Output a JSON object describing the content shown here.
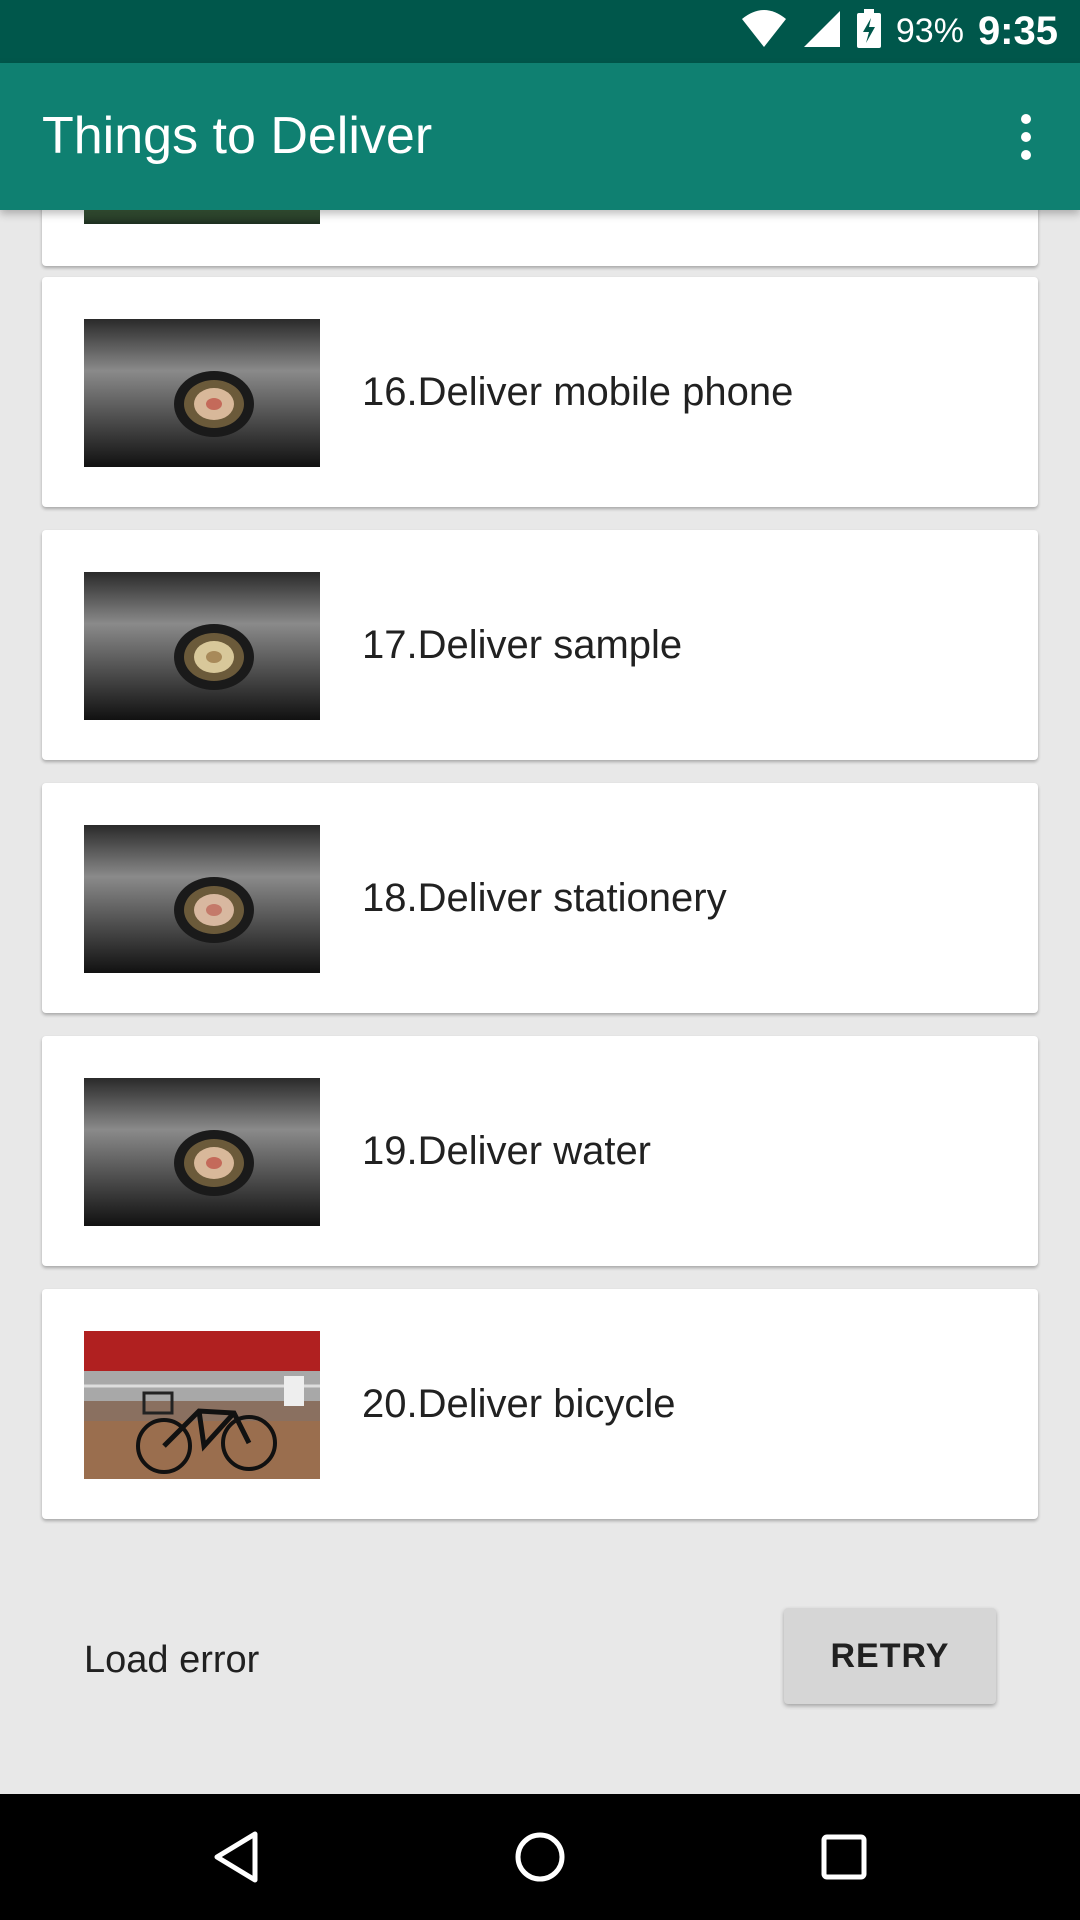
{
  "status_bar": {
    "battery_percent": "93%",
    "time": "9:35",
    "icons": [
      "wifi-icon",
      "signal-icon",
      "battery-charging-icon"
    ]
  },
  "app_bar": {
    "title": "Things to Deliver",
    "menu_icon": "overflow-menu-icon"
  },
  "items": [
    {
      "label": "16.Deliver mobile phone",
      "thumbnail": "camera-lens-photo"
    },
    {
      "label": "17.Deliver sample",
      "thumbnail": "camera-lens-photo"
    },
    {
      "label": "18.Deliver stationery",
      "thumbnail": "camera-lens-photo"
    },
    {
      "label": "19.Deliver water",
      "thumbnail": "camera-lens-photo"
    },
    {
      "label": "20.Deliver bicycle",
      "thumbnail": "bicycle-photo"
    }
  ],
  "footer": {
    "error_text": "Load error",
    "retry_label": "RETRY"
  },
  "nav_bar": {
    "buttons": [
      "back-icon",
      "home-icon",
      "recents-icon"
    ]
  },
  "colors": {
    "status_bar": "#00574b",
    "app_bar": "#0f8071",
    "background": "#e8e8e8",
    "card": "#ffffff",
    "retry_button": "#d6d6d6"
  }
}
